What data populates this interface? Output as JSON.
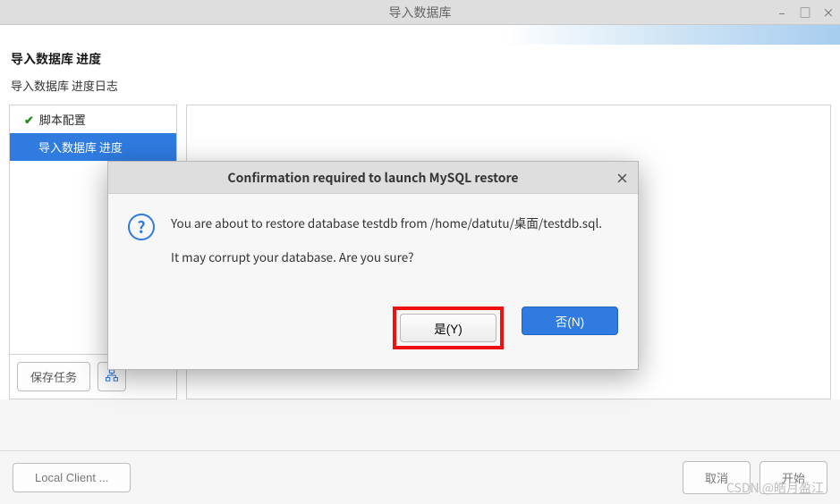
{
  "window": {
    "title": "导入数据库",
    "minimize": "–",
    "maximize": "□",
    "close": "×"
  },
  "header": {
    "title": "导入数据库 进度"
  },
  "subheader": {
    "text": "导入数据库 进度日志"
  },
  "sidebar": {
    "items": [
      {
        "label": "脚本配置",
        "checked": true
      },
      {
        "label": "导入数据库 进度",
        "selected": true
      }
    ],
    "save_task_label": "保存任务",
    "tree_icon": "⎙"
  },
  "footer": {
    "local_client_label": "Local Client ...",
    "cancel_label": "取消",
    "start_label": "开始"
  },
  "modal": {
    "title": "Confirmation required to launch MySQL restore",
    "close": "×",
    "line1": "You are about to restore database testdb from /home/datutu/桌面/testdb.sql.",
    "line2": "It may corrupt your database. Are you sure?",
    "yes_label": "是(Y)",
    "no_label": "否(N)"
  },
  "watermark": "CSDN @皓月盈江"
}
